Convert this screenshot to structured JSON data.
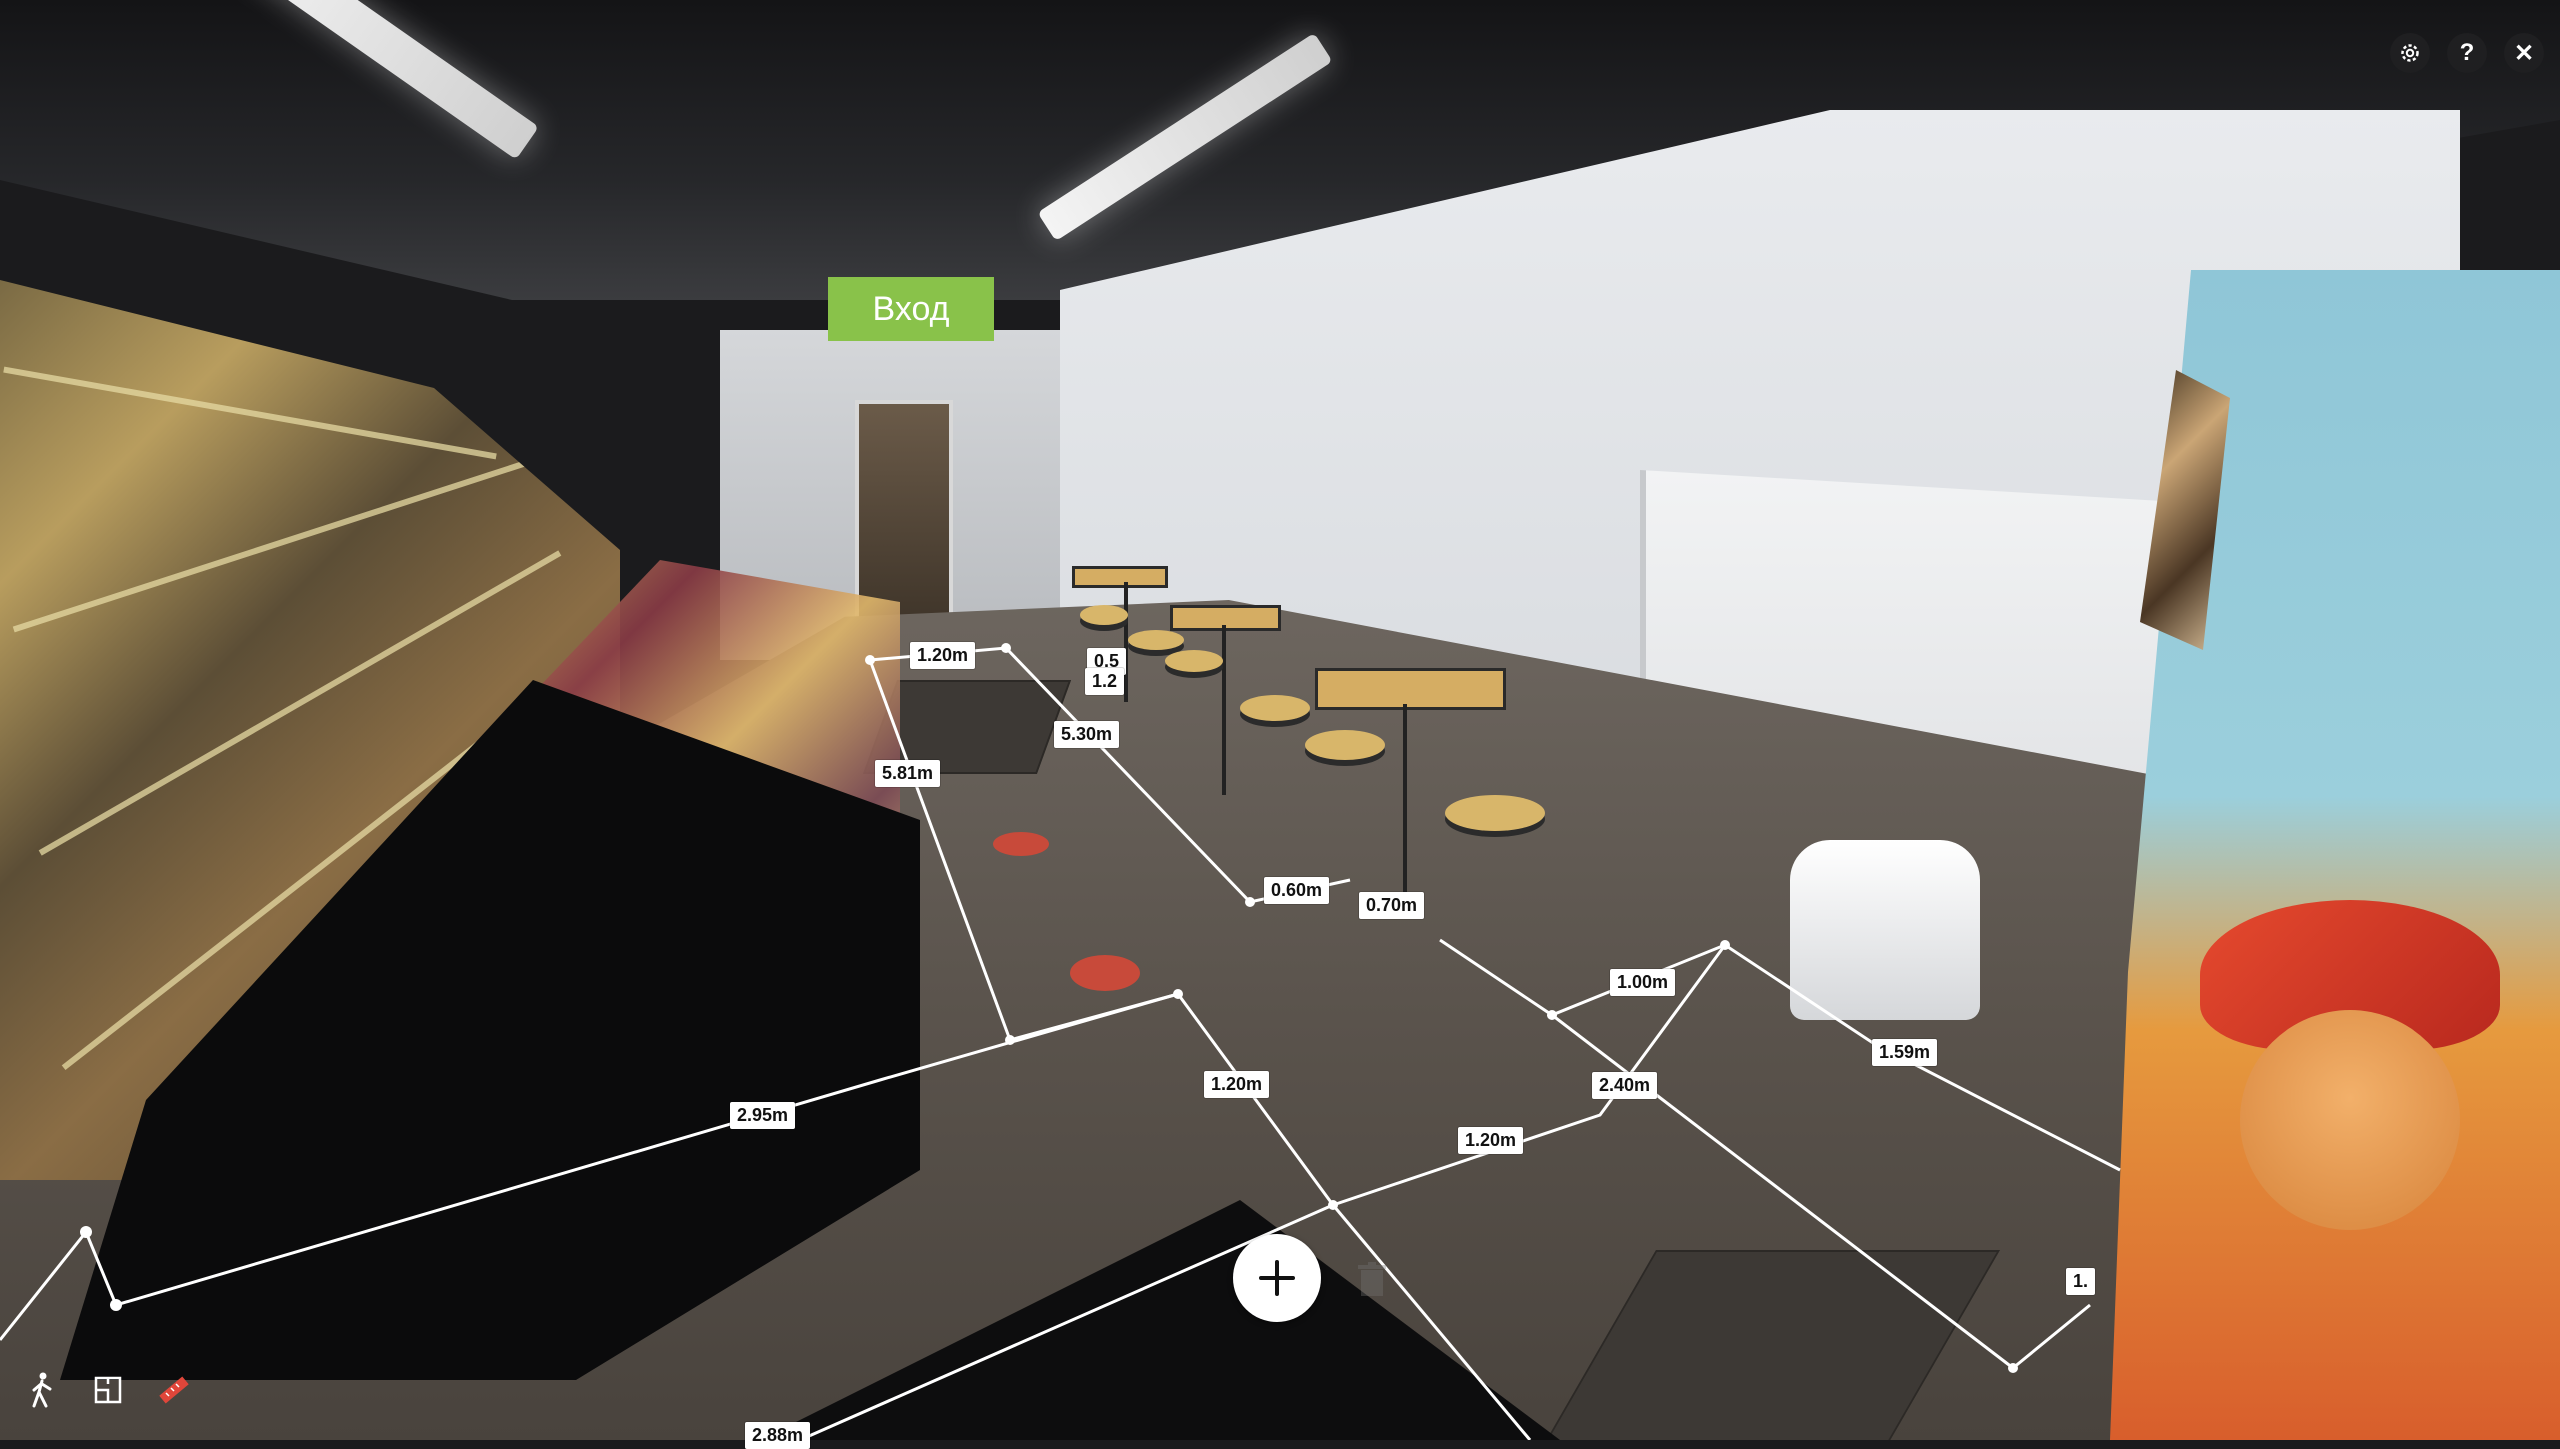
{
  "tag": {
    "label": "Вход"
  },
  "top_controls": [
    {
      "name": "settings",
      "icon": "gear-icon"
    },
    {
      "name": "help",
      "icon": "help-icon",
      "glyph": "?"
    },
    {
      "name": "close",
      "icon": "close-icon",
      "glyph": "✕"
    }
  ],
  "measurements": [
    "1.20m",
    "0.5",
    "1.2",
    "5.30m",
    "5.81m",
    "0.60m",
    "0.70m",
    "1.00m",
    "1.59m",
    "2.40m",
    "1.20m",
    "1.20m",
    "2.95m",
    "2.88m",
    "1."
  ],
  "toolbar": {
    "walk_icon": "walk-icon",
    "floorplan_icon": "floorplan-icon",
    "measure_icon": "measure-icon"
  },
  "add_button": {
    "icon": "plus-icon"
  },
  "trash": {
    "icon": "trash-icon"
  },
  "colors": {
    "tag_green": "#89c24a",
    "measure_white": "#ffffff",
    "measure_active": "#e0463a"
  }
}
